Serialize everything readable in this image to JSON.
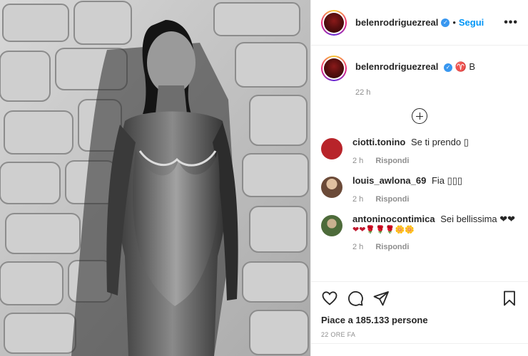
{
  "header": {
    "username": "belenrodriguezreal",
    "follow_label": "Segui",
    "more_label": "•••"
  },
  "caption": {
    "username": "belenrodriguezreal",
    "text": "♈ B",
    "time": "22 h"
  },
  "comments": [
    {
      "username": "ciotti.tonino",
      "text": "Se ti prendo ▯",
      "time": "2 h",
      "reply": "Rispondi",
      "avatar_color": "#b8242a"
    },
    {
      "username": "louis_awlona_69",
      "text": "Fia ▯▯▯",
      "time": "2 h",
      "reply": "Rispondi",
      "avatar_color": "#6b4a38"
    },
    {
      "username": "antoninocontimica",
      "text": "Sei bellissima ❤❤",
      "extra": "❤❤🌹🌹🌹🌼🌼",
      "time": "2 h",
      "reply": "Rispondi",
      "avatar_color": "#4d6b3a"
    }
  ],
  "actions": {
    "likes": "Piace a 185.133 persone",
    "posted": "22 ORE FA"
  },
  "colors": {
    "accent": "#0095f6",
    "verified": "#3897f0",
    "muted": "#8e8e8e"
  }
}
